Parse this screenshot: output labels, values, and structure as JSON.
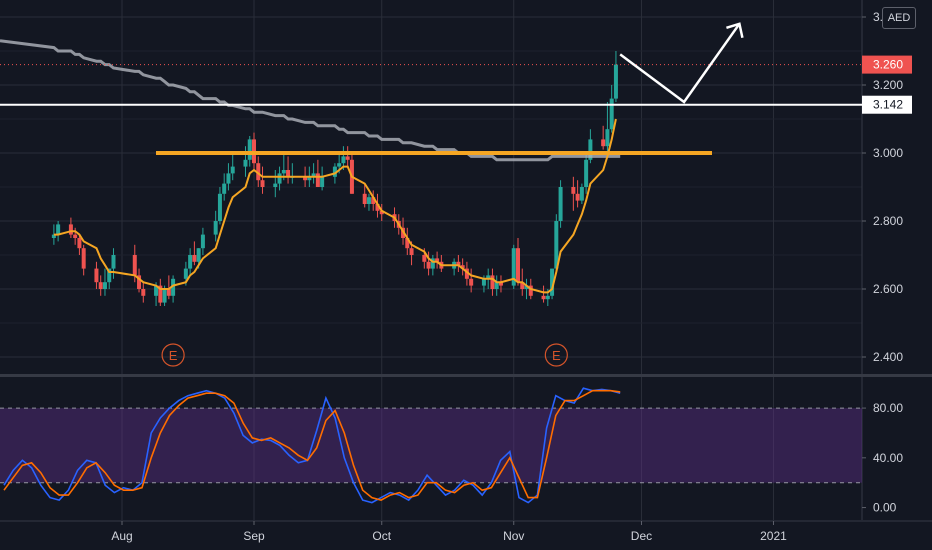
{
  "currency": "AED",
  "colors": {
    "background": "#131722",
    "up": "#26a69a",
    "down": "#ef5350",
    "ma_fast": "#f5a623",
    "ma_slow": "#b2b5be",
    "resistance": "#f5a623",
    "support_line": "#ffffff",
    "rsi_zone": "#5a2f86",
    "stoch_k": "#2962ff",
    "stoch_d": "#ff6d00"
  },
  "price_tags": [
    {
      "value": "3.260",
      "color": "#ef5350",
      "text_color": "#ffffff"
    },
    {
      "value": "3.142",
      "color": "#ffffff",
      "text_color": "#131722"
    }
  ],
  "earnings_marker": "E",
  "chart_data": [
    {
      "type": "candlestick",
      "x_ticks": [
        "Aug",
        "Sep",
        "Oct",
        "Nov",
        "Dec",
        "2021"
      ],
      "y_ticks": [
        "3.400",
        "3.200",
        "3.000",
        "2.800",
        "2.600",
        "2.400"
      ],
      "ylim": [
        2.35,
        3.45
      ],
      "last_price": 3.26,
      "horizontal_lines": [
        {
          "name": "support",
          "value": 3.142
        },
        {
          "name": "resistance",
          "value": 3.0
        }
      ],
      "earnings_dates": [
        "2020-08-13",
        "2020-11-11"
      ],
      "dates": [
        "2020-07-16",
        "2020-07-17",
        "2020-07-20",
        "2020-07-21",
        "2020-07-22",
        "2020-07-23",
        "2020-07-26",
        "2020-07-27",
        "2020-07-28",
        "2020-07-29",
        "2020-07-30",
        "2020-08-04",
        "2020-08-05",
        "2020-08-06",
        "2020-08-09",
        "2020-08-10",
        "2020-08-11",
        "2020-08-12",
        "2020-08-13",
        "2020-08-16",
        "2020-08-17",
        "2020-08-18",
        "2020-08-19",
        "2020-08-20",
        "2020-08-23",
        "2020-08-24",
        "2020-08-25",
        "2020-08-26",
        "2020-08-27",
        "2020-08-30",
        "2020-08-31",
        "2020-09-01",
        "2020-09-02",
        "2020-09-03",
        "2020-09-06",
        "2020-09-07",
        "2020-09-08",
        "2020-09-09",
        "2020-09-10",
        "2020-09-13",
        "2020-09-14",
        "2020-09-15",
        "2020-09-16",
        "2020-09-17",
        "2020-09-20",
        "2020-09-21",
        "2020-09-22",
        "2020-09-23",
        "2020-09-24",
        "2020-09-27",
        "2020-09-28",
        "2020-09-29",
        "2020-09-30",
        "2020-10-01",
        "2020-10-04",
        "2020-10-05",
        "2020-10-06",
        "2020-10-07",
        "2020-10-08",
        "2020-10-11",
        "2020-10-12",
        "2020-10-13",
        "2020-10-14",
        "2020-10-15",
        "2020-10-18",
        "2020-10-19",
        "2020-10-20",
        "2020-10-21",
        "2020-10-22",
        "2020-10-25",
        "2020-10-26",
        "2020-10-27",
        "2020-10-28",
        "2020-10-29",
        "2020-11-01",
        "2020-11-02",
        "2020-11-03",
        "2020-11-04",
        "2020-11-05",
        "2020-11-08",
        "2020-11-09",
        "2020-11-10",
        "2020-11-11",
        "2020-11-12",
        "2020-11-15",
        "2020-11-16",
        "2020-11-17",
        "2020-11-18",
        "2020-11-19",
        "2020-11-22",
        "2020-11-23",
        "2020-11-24",
        "2020-11-25"
      ],
      "series": [
        {
          "name": "open",
          "values": [
            2.75,
            2.76,
            2.79,
            2.76,
            2.75,
            2.72,
            2.66,
            2.62,
            2.6,
            2.62,
            2.66,
            2.7,
            2.64,
            2.6,
            2.58,
            2.61,
            2.56,
            2.6,
            2.58,
            2.63,
            2.66,
            2.7,
            2.68,
            2.72,
            2.76,
            2.8,
            2.88,
            2.91,
            2.94,
            2.96,
            2.98,
            3.04,
            2.97,
            2.92,
            2.9,
            2.91,
            2.94,
            2.95,
            2.93,
            2.93,
            2.92,
            2.93,
            2.94,
            2.9,
            2.93,
            2.96,
            2.97,
            2.99,
            2.98,
            2.88,
            2.85,
            2.87,
            2.85,
            2.83,
            2.82,
            2.8,
            2.78,
            2.75,
            2.72,
            2.7,
            2.68,
            2.66,
            2.69,
            2.68,
            2.66,
            2.68,
            2.67,
            2.66,
            2.63,
            2.61,
            2.63,
            2.64,
            2.6,
            2.62,
            2.61,
            2.72,
            2.62,
            2.6,
            2.61,
            2.58,
            2.57,
            2.58,
            2.66,
            2.8,
            2.9,
            2.88,
            2.86,
            2.9,
            2.98,
            3.04,
            3.02,
            3.07,
            3.16
          ]
        },
        {
          "name": "high",
          "values": [
            2.79,
            2.8,
            2.81,
            2.78,
            2.76,
            2.73,
            2.68,
            2.64,
            2.66,
            2.66,
            2.72,
            2.73,
            2.66,
            2.62,
            2.62,
            2.63,
            2.61,
            2.64,
            2.64,
            2.68,
            2.72,
            2.74,
            2.72,
            2.78,
            2.83,
            2.9,
            2.94,
            2.97,
            3.0,
            3.02,
            3.05,
            3.06,
            2.99,
            2.96,
            2.95,
            2.96,
            3.0,
            2.99,
            2.97,
            2.96,
            2.96,
            2.97,
            2.98,
            2.96,
            2.97,
            3.0,
            3.02,
            3.02,
            3.0,
            2.91,
            2.88,
            2.89,
            2.88,
            2.85,
            2.84,
            2.82,
            2.81,
            2.78,
            2.74,
            2.72,
            2.71,
            2.7,
            2.71,
            2.7,
            2.69,
            2.7,
            2.69,
            2.68,
            2.66,
            2.64,
            2.66,
            2.66,
            2.64,
            2.64,
            2.73,
            2.75,
            2.66,
            2.63,
            2.63,
            2.61,
            2.6,
            2.66,
            2.82,
            2.92,
            2.93,
            2.92,
            2.91,
            3.0,
            3.07,
            3.08,
            3.15,
            3.2,
            3.3
          ]
        },
        {
          "name": "low",
          "values": [
            2.73,
            2.74,
            2.75,
            2.73,
            2.7,
            2.64,
            2.6,
            2.58,
            2.58,
            2.6,
            2.63,
            2.62,
            2.59,
            2.56,
            2.55,
            2.55,
            2.55,
            2.57,
            2.56,
            2.61,
            2.64,
            2.67,
            2.66,
            2.7,
            2.74,
            2.79,
            2.86,
            2.89,
            2.92,
            2.93,
            2.96,
            2.95,
            2.9,
            2.88,
            2.87,
            2.89,
            2.92,
            2.91,
            2.91,
            2.9,
            2.9,
            2.91,
            2.91,
            2.89,
            2.91,
            2.94,
            2.95,
            2.96,
            2.88,
            2.84,
            2.83,
            2.83,
            2.81,
            2.8,
            2.78,
            2.76,
            2.73,
            2.7,
            2.67,
            2.66,
            2.64,
            2.64,
            2.66,
            2.65,
            2.64,
            2.65,
            2.64,
            2.61,
            2.59,
            2.59,
            2.6,
            2.58,
            2.58,
            2.59,
            2.6,
            2.61,
            2.58,
            2.57,
            2.57,
            2.56,
            2.55,
            2.57,
            2.65,
            2.78,
            2.83,
            2.84,
            2.85,
            2.88,
            2.97,
            3.01,
            3.0,
            3.06,
            3.15
          ]
        },
        {
          "name": "close",
          "values": [
            2.76,
            2.79,
            2.76,
            2.75,
            2.72,
            2.66,
            2.62,
            2.6,
            2.62,
            2.66,
            2.7,
            2.64,
            2.6,
            2.58,
            2.61,
            2.56,
            2.6,
            2.58,
            2.63,
            2.66,
            2.7,
            2.68,
            2.72,
            2.76,
            2.8,
            2.88,
            2.91,
            2.94,
            2.96,
            2.98,
            3.04,
            2.97,
            2.92,
            2.9,
            2.91,
            2.94,
            2.95,
            2.93,
            2.93,
            2.92,
            2.93,
            2.94,
            2.9,
            2.93,
            2.96,
            2.97,
            2.99,
            2.98,
            2.88,
            2.85,
            2.87,
            2.85,
            2.83,
            2.82,
            2.8,
            2.78,
            2.75,
            2.72,
            2.7,
            2.68,
            2.66,
            2.69,
            2.68,
            2.66,
            2.68,
            2.67,
            2.66,
            2.63,
            2.61,
            2.63,
            2.64,
            2.6,
            2.62,
            2.61,
            2.72,
            2.62,
            2.6,
            2.61,
            2.58,
            2.57,
            2.58,
            2.66,
            2.8,
            2.9,
            2.88,
            2.86,
            2.9,
            2.98,
            3.04,
            3.02,
            3.07,
            3.16,
            3.26
          ]
        }
      ],
      "ma_fast_values": [
        2.76,
        2.76,
        2.77,
        2.77,
        2.76,
        2.74,
        2.72,
        2.69,
        2.67,
        2.65,
        2.65,
        2.64,
        2.63,
        2.62,
        2.61,
        2.6,
        2.6,
        2.6,
        2.61,
        2.62,
        2.64,
        2.65,
        2.67,
        2.69,
        2.72,
        2.76,
        2.8,
        2.84,
        2.87,
        2.9,
        2.94,
        2.95,
        2.94,
        2.93,
        2.93,
        2.93,
        2.93,
        2.93,
        2.93,
        2.93,
        2.93,
        2.93,
        2.93,
        2.93,
        2.94,
        2.95,
        2.96,
        2.96,
        2.93,
        2.91,
        2.89,
        2.87,
        2.85,
        2.83,
        2.81,
        2.79,
        2.77,
        2.75,
        2.73,
        2.71,
        2.69,
        2.68,
        2.68,
        2.67,
        2.67,
        2.67,
        2.66,
        2.65,
        2.64,
        2.63,
        2.63,
        2.63,
        2.62,
        2.62,
        2.63,
        2.62,
        2.62,
        2.61,
        2.6,
        2.59,
        2.59,
        2.6,
        2.65,
        2.71,
        2.76,
        2.79,
        2.82,
        2.86,
        2.91,
        2.95,
        2.99,
        3.04,
        3.1
      ],
      "ma_slow_values": [
        3.31,
        3.3,
        3.3,
        3.29,
        3.29,
        3.28,
        3.27,
        3.27,
        3.26,
        3.26,
        3.25,
        3.24,
        3.24,
        3.23,
        3.22,
        3.22,
        3.21,
        3.2,
        3.2,
        3.19,
        3.18,
        3.18,
        3.17,
        3.16,
        3.16,
        3.15,
        3.15,
        3.14,
        3.14,
        3.13,
        3.13,
        3.12,
        3.12,
        3.12,
        3.11,
        3.11,
        3.11,
        3.1,
        3.1,
        3.09,
        3.09,
        3.09,
        3.08,
        3.08,
        3.08,
        3.07,
        3.07,
        3.06,
        3.06,
        3.06,
        3.05,
        3.05,
        3.05,
        3.04,
        3.04,
        3.04,
        3.03,
        3.03,
        3.03,
        3.02,
        3.02,
        3.02,
        3.01,
        3.01,
        3.01,
        3.0,
        3.0,
        3.0,
        2.99,
        2.99,
        2.99,
        2.99,
        2.98,
        2.98,
        2.98,
        2.98,
        2.98,
        2.98,
        2.98,
        2.98,
        2.98,
        2.99,
        2.99,
        2.99,
        2.99,
        2.99,
        2.99,
        2.99,
        2.99,
        2.99,
        2.99,
        2.99,
        2.99
      ]
    },
    {
      "type": "line",
      "x_ticks": [
        "Aug",
        "Sep",
        "Oct",
        "Nov",
        "Dec",
        "2021"
      ],
      "y_ticks": [
        "80.00",
        "40.00",
        "0.00"
      ],
      "ylim": [
        -10,
        105
      ],
      "band": [
        20,
        80
      ],
      "series": [
        {
          "values": [
            18,
            30,
            38,
            32,
            18,
            8,
            6,
            14,
            30,
            38,
            36,
            18,
            12,
            16,
            14,
            20,
            60,
            72,
            80,
            86,
            90,
            92,
            94,
            92,
            88,
            76,
            58,
            52,
            55,
            54,
            50,
            42,
            36,
            38,
            62,
            88,
            72,
            40,
            20,
            6,
            4,
            8,
            12,
            10,
            6,
            14,
            26,
            18,
            10,
            14,
            22,
            18,
            10,
            20,
            38,
            45,
            8,
            4,
            10,
            64,
            90,
            86,
            84,
            96,
            94,
            95,
            94,
            92
          ]
        },
        {
          "values": [
            14,
            24,
            34,
            36,
            28,
            16,
            10,
            10,
            20,
            32,
            36,
            28,
            18,
            14,
            14,
            16,
            40,
            60,
            74,
            82,
            88,
            90,
            92,
            92,
            90,
            84,
            68,
            56,
            54,
            56,
            52,
            48,
            42,
            38,
            48,
            70,
            78,
            60,
            34,
            14,
            8,
            6,
            10,
            12,
            8,
            10,
            20,
            20,
            14,
            12,
            18,
            20,
            14,
            16,
            28,
            40,
            24,
            8,
            8,
            40,
            74,
            86,
            86,
            90,
            94,
            94,
            94,
            93
          ]
        }
      ]
    }
  ]
}
